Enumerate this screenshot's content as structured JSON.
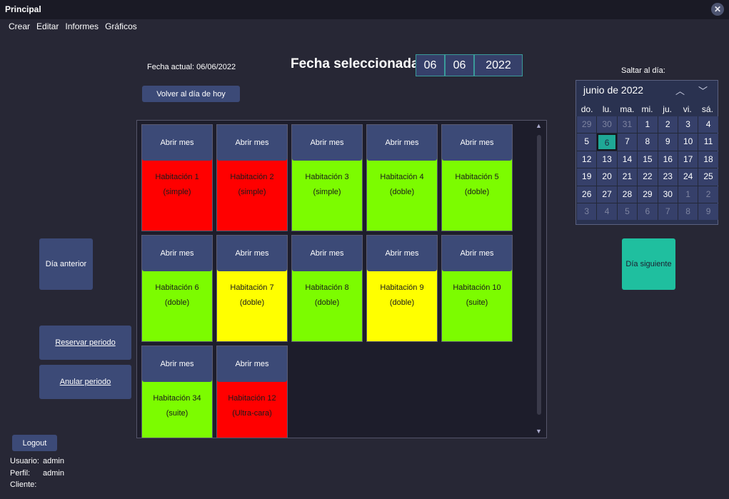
{
  "window": {
    "title": "Principal"
  },
  "menu": [
    "Crear",
    "Editar",
    "Informes",
    "Gráficos"
  ],
  "header": {
    "fecha_actual": "Fecha actual: 06/06/2022",
    "volver_label": "Volver al día de hoy",
    "fecha_sel_label": "Fecha seleccionada:",
    "day": "06",
    "month": "06",
    "year": "2022"
  },
  "left": {
    "prev_day": "Día anterior",
    "reserve": "Reservar periodo",
    "cancel": "Anular periodo",
    "logout": "Logout"
  },
  "user": {
    "usuario_label": "Usuario:",
    "usuario": "admin",
    "perfil_label": "Perfil:",
    "perfil": "admin",
    "cliente_label": "Cliente:",
    "cliente": ""
  },
  "rooms": [
    {
      "open": "Abrir mes",
      "name": "Habitación 1",
      "type": "(simple)",
      "color": "#ff0000"
    },
    {
      "open": "Abrir mes",
      "name": "Habitación 2",
      "type": "(simple)",
      "color": "#ff0000"
    },
    {
      "open": "Abrir mes",
      "name": "Habitación 3",
      "type": "(simple)",
      "color": "#7cfc00"
    },
    {
      "open": "Abrir mes",
      "name": "Habitación 4",
      "type": "(doble)",
      "color": "#7cfc00"
    },
    {
      "open": "Abrir mes",
      "name": "Habitación 5",
      "type": "(doble)",
      "color": "#7cfc00"
    },
    {
      "open": "Abrir mes",
      "name": "Habitación 6",
      "type": "(doble)",
      "color": "#7cfc00"
    },
    {
      "open": "Abrir mes",
      "name": "Habitación 7",
      "type": "(doble)",
      "color": "#ffff00"
    },
    {
      "open": "Abrir mes",
      "name": "Habitación 8",
      "type": "(doble)",
      "color": "#7cfc00"
    },
    {
      "open": "Abrir mes",
      "name": "Habitación 9",
      "type": "(doble)",
      "color": "#ffff00"
    },
    {
      "open": "Abrir mes",
      "name": "Habitación 10",
      "type": "(suite)",
      "color": "#7cfc00"
    },
    {
      "open": "Abrir mes",
      "name": "Habitación 34",
      "type": "(suite)",
      "color": "#7cfc00"
    },
    {
      "open": "Abrir mes",
      "name": "Habitación 12",
      "type": "(Ultra-cara)",
      "color": "#ff0000"
    }
  ],
  "calendar": {
    "jump_label": "Saltar al día:",
    "month_label": "junio de 2022",
    "dow": [
      "do.",
      "lu.",
      "ma.",
      "mi.",
      "ju.",
      "vi.",
      "sá."
    ],
    "days": [
      [
        "29",
        "30",
        "31",
        "1",
        "2",
        "3",
        "4"
      ],
      [
        "5",
        "6",
        "7",
        "8",
        "9",
        "10",
        "11"
      ],
      [
        "12",
        "13",
        "14",
        "15",
        "16",
        "17",
        "18"
      ],
      [
        "19",
        "20",
        "21",
        "22",
        "23",
        "24",
        "25"
      ],
      [
        "26",
        "27",
        "28",
        "29",
        "30",
        "1",
        "2"
      ],
      [
        "3",
        "4",
        "5",
        "6",
        "7",
        "8",
        "9"
      ]
    ],
    "selected_day": "6"
  },
  "right": {
    "next_day": "Día siguiente"
  }
}
